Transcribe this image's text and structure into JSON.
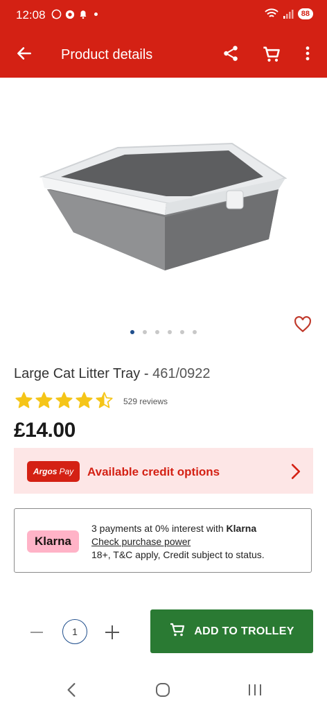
{
  "status_bar": {
    "time": "12:08",
    "battery": "88"
  },
  "app_bar": {
    "title": "Product details"
  },
  "product": {
    "name": "Large Cat Litter Tray",
    "separator": " - ",
    "code": "461/0922",
    "rating": 4.5,
    "reviews": "529 reviews",
    "price": "£14.00",
    "image_count": 6,
    "active_image_index": 0
  },
  "credit": {
    "badge_bold": "Argos",
    "badge_rest": "Pay",
    "label": "Available credit options"
  },
  "klarna": {
    "logo": "Klarna",
    "line1_prefix": "3 payments at 0% interest with ",
    "line1_brand": "Klarna",
    "link": "Check purchase power",
    "line3": "18+, T&C apply, Credit subject to status."
  },
  "purchase": {
    "quantity": "1",
    "add_button": "ADD TO TROLLEY"
  },
  "colors": {
    "brand_red": "#d42114",
    "button_green": "#2a7a33",
    "klarna_pink": "#ffb3c7",
    "star_yellow": "#f5c518"
  },
  "icons": [
    "back-arrow-icon",
    "share-icon",
    "cart-icon",
    "more-vert-icon",
    "heart-icon",
    "star-icon",
    "chevron-right-icon",
    "trolley-icon",
    "nav-back-icon",
    "nav-home-icon",
    "nav-recents-icon"
  ]
}
